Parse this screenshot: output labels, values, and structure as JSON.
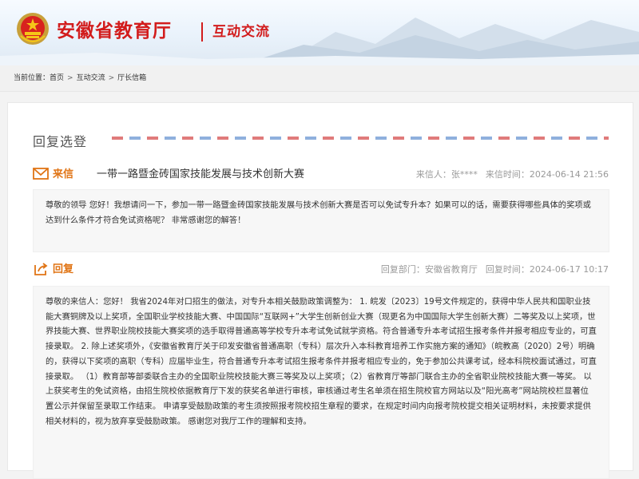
{
  "header": {
    "site_title": "安徽省教育厅",
    "section_title": "互动交流"
  },
  "breadcrumb": {
    "prefix": "当前位置：",
    "items": [
      "首页",
      "互动交流",
      "厅长信箱"
    ],
    "separator": ">"
  },
  "reply_section": {
    "title": "回复选登"
  },
  "letter": {
    "tag": "来信",
    "subject": "一带一路暨金砖国家技能发展与技术创新大赛",
    "sender_label": "来信人：",
    "sender": "张****",
    "time_label": "来信时间：",
    "time": "2024-06-14 21:56",
    "body": "尊敬的领导 您好！我想请问一下，参加一带一路暨金砖国家技能发展与技术创新大赛是否可以免试专升本？如果可以的话，需要获得哪些具体的奖项或达到什么条件才符合免试资格呢？ 非常感谢您的解答！"
  },
  "reply": {
    "tag": "回复",
    "dept_label": "回复部门：",
    "dept": "安徽省教育厅",
    "time_label": "回复时间：",
    "time": "2024-06-17 10:17",
    "body": "尊敬的来信人：您好！ 我省2024年对口招生的做法，对专升本相关鼓励政策调整为： 1. 皖发〔2023〕19号文件规定的，获得中华人民共和国职业技能大赛铜牌及以上奖项，全国职业学校技能大赛、中国国际“互联网+”大学生创新创业大赛（现更名为中国国际大学生创新大赛）二等奖及以上奖项，世界技能大赛、世界职业院校技能大赛奖项的选手取得普通高等学校专升本考试免试就学资格。符合普通专升本考试招生报考条件并报考相应专业的，可直接录取。 2. 除上述奖项外，《安徽省教育厅关于印发安徽省普通高职（专科）层次升入本科教育培养工作实施方案的通知》（皖教高〔2020〕2号）明确的，获得以下奖项的高职（专科）应届毕业生，符合普通专升本考试招生报考条件并报考相应专业的，免于参加公共课考试，经本科院校面试通过，可直接录取。 （1）教育部等部委联合主办的全国职业院校技能大赛三等奖及以上奖项；（2）省教育厅等部门联合主办的全省职业院校技能大赛一等奖。 以上获奖考生的免试资格，由招生院校依据教育厅下发的获奖名单进行审核，审核通过考生名单须在招生院校官方网站以及“阳光高考”网站院校栏显著位置公示并保留至录取工作结束。 申请享受鼓励政策的考生须按照报考院校招生章程的要求，在规定时间内向报考院校提交相关证明材料，未按要求提供相关材料的，视为放弃享受鼓励政策。 感谢您对我厅工作的理解和支持。"
  },
  "colors": {
    "brand_red": "#d21c1c",
    "accent_orange": "#e07415"
  }
}
